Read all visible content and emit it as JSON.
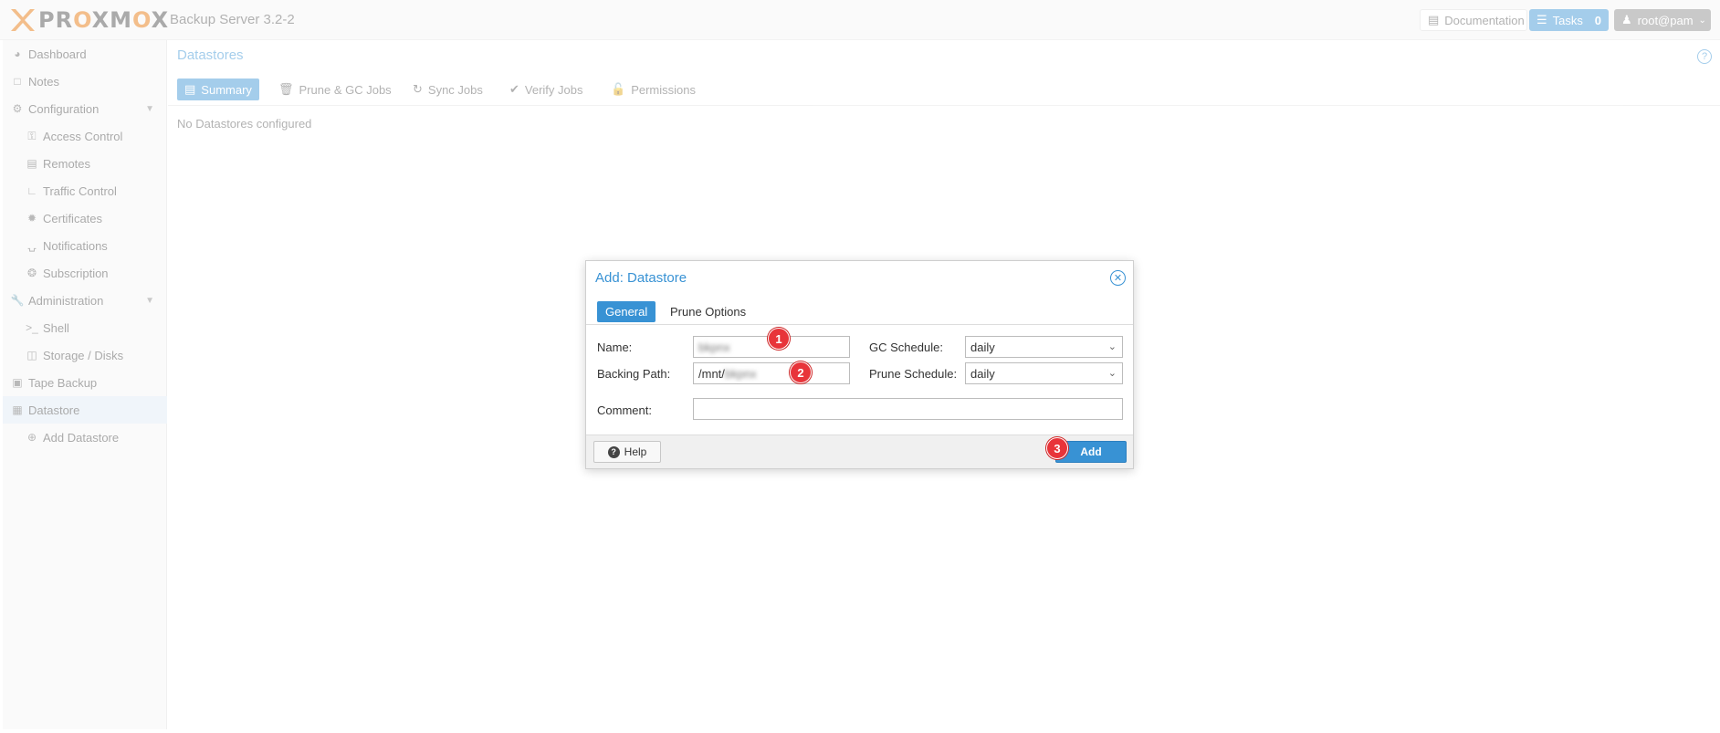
{
  "header": {
    "logo_text": "PROXMOX",
    "product": "Backup Server 3.2-2",
    "documentation_label": "Documentation",
    "tasks_label": "Tasks",
    "tasks_count": "0",
    "user_label": "root@pam"
  },
  "sidebar": {
    "items": [
      {
        "label": "Dashboard",
        "icon": "dashboard-icon"
      },
      {
        "label": "Notes",
        "icon": "note-icon"
      },
      {
        "label": "Configuration",
        "icon": "gears-icon"
      },
      {
        "label": "Access Control",
        "icon": "key-icon"
      },
      {
        "label": "Remotes",
        "icon": "server-icon"
      },
      {
        "label": "Traffic Control",
        "icon": "chart-icon"
      },
      {
        "label": "Certificates",
        "icon": "certificate-icon"
      },
      {
        "label": "Notifications",
        "icon": "bell-icon"
      },
      {
        "label": "Subscription",
        "icon": "lifebuoy-icon"
      },
      {
        "label": "Administration",
        "icon": "wrench-icon"
      },
      {
        "label": "Shell",
        "icon": "terminal-icon"
      },
      {
        "label": "Storage / Disks",
        "icon": "hdd-icon"
      },
      {
        "label": "Tape Backup",
        "icon": "tape-icon"
      },
      {
        "label": "Datastore",
        "icon": "archive-icon"
      },
      {
        "label": "Add Datastore",
        "icon": "plus-circle-icon"
      }
    ]
  },
  "main": {
    "title": "Datastores",
    "tabs": [
      {
        "label": "Summary",
        "icon": "book-icon"
      },
      {
        "label": "Prune & GC Jobs",
        "icon": "trash-icon"
      },
      {
        "label": "Sync Jobs",
        "icon": "refresh-icon"
      },
      {
        "label": "Verify Jobs",
        "icon": "check-circle-icon"
      },
      {
        "label": "Permissions",
        "icon": "unlock-icon"
      }
    ],
    "empty_text": "No Datastores configured"
  },
  "dialog": {
    "title": "Add: Datastore",
    "tabs": [
      "General",
      "Prune Options"
    ],
    "name_label": "Name:",
    "name_value": "bkpnx",
    "backing_path_label": "Backing Path:",
    "backing_path_prefix": "/mnt/",
    "backing_path_value": "bkpnx",
    "comment_label": "Comment:",
    "comment_value": "",
    "gc_schedule_label": "GC Schedule:",
    "gc_schedule_value": "daily",
    "prune_schedule_label": "Prune Schedule:",
    "prune_schedule_value": "daily",
    "help_label": "Help",
    "add_label": "Add"
  },
  "markers": [
    "1",
    "2",
    "3"
  ],
  "colors": {
    "accent": "#3892d4",
    "brand_orange": "#e57000",
    "marker_red": "#e8343a"
  }
}
